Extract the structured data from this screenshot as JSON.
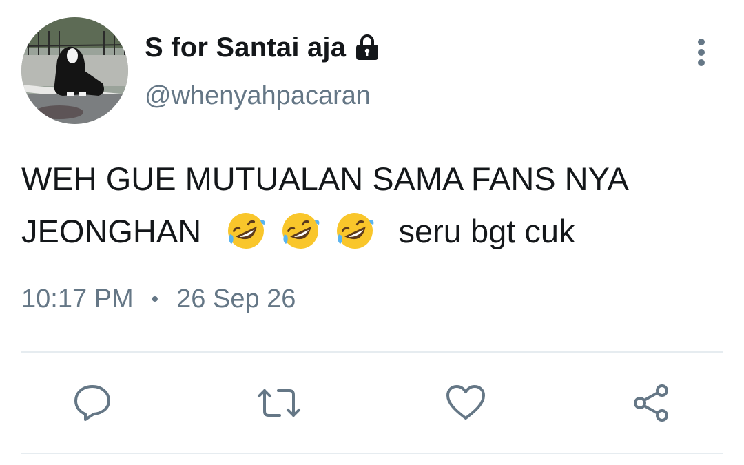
{
  "tweet": {
    "display_name": "S for Santai aja",
    "handle": "@whenyahpacaran",
    "text_line1": "WEH GUE MUTUALAN SAMA FANS NYA",
    "text_line2_prefix": "JEONGHAN",
    "text_line2_suffix": "seru bgt cuk",
    "emoji_name": "rolling-on-the-floor-laughing",
    "emoji_count": 3,
    "time": "10:17 PM",
    "separator": "•",
    "date": "26 Sep 26",
    "protected": true
  },
  "actions": {
    "reply_icon": "reply-icon",
    "retweet_icon": "retweet-icon",
    "like_icon": "heart-icon",
    "share_icon": "share-icon"
  },
  "colors": {
    "text": "#14171a",
    "secondary": "#657786",
    "divider": "#e6ecf0"
  }
}
